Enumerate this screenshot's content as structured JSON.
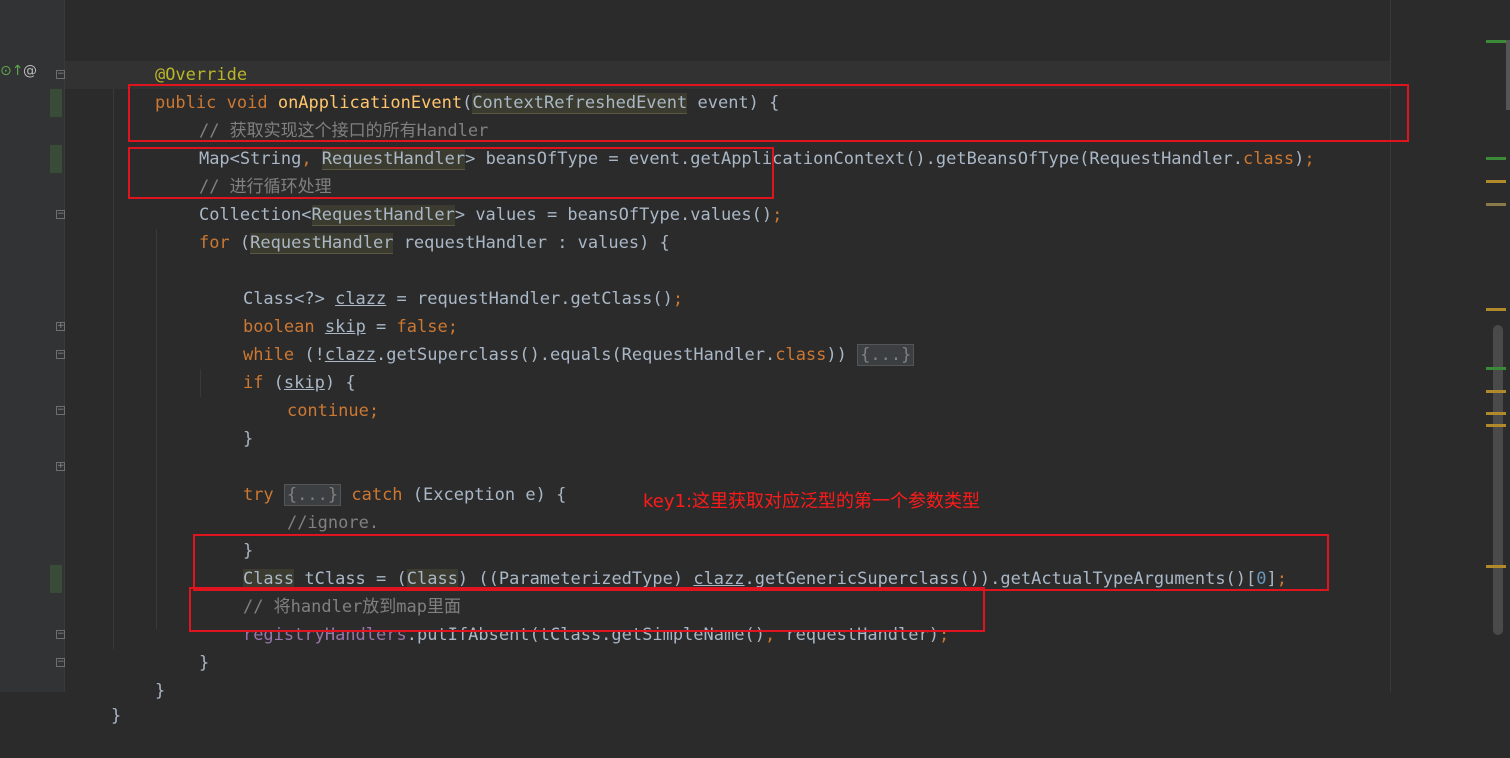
{
  "editor": {
    "lines": {
      "l0": {
        "text": "@Override"
      },
      "l1": {
        "kw_public": "public",
        "kw_void": "void",
        "method": "onApplicationEvent",
        "paren_open": "(",
        "param_type": "ContextRefreshedEvent",
        "param_rest": " event) {"
      },
      "l2": {
        "comment": "// 获取实现这个接口的所有Handler"
      },
      "l3": {
        "a": "Map<String",
        "comma": ", ",
        "hl": "RequestHandler",
        "b": "> beansOfType = event.getApplicationContext().getBeansOfType(RequestHandler.",
        "kw": "class",
        "c": ")",
        "semi": ";"
      },
      "l4": {
        "comment": "// 进行循环处理"
      },
      "l5": {
        "a": "Collection<",
        "hl": "RequestHandler",
        "b": "> values = beansOfType.values()",
        "semi": ";"
      },
      "l6": {
        "kw": "for",
        "a": " (",
        "hl": "RequestHandler",
        "b": " requestHandler : values) {"
      },
      "l7": {
        "a": "Class<?> ",
        "var": "clazz",
        "b": " = requestHandler.getClass()",
        "semi": ";"
      },
      "l8": {
        "kw": "boolean",
        "sp": " ",
        "var": "skip",
        "b": " = ",
        "kw2": "false",
        "semi": ";"
      },
      "l9": {
        "kw": "while",
        "a": " (!",
        "var": "clazz",
        "b": ".getSuperclass().equals(RequestHandler.",
        "kw2": "class",
        "c": ")) ",
        "fold": "{...}"
      },
      "l10": {
        "kw": "if",
        "a": " (",
        "var": "skip",
        "b": ") {"
      },
      "l11": {
        "kw": "continue",
        "semi": ";"
      },
      "l12": {
        "a": "}"
      },
      "l13": {
        "kw": "try",
        "sp": " ",
        "fold": "{...}",
        "sp2": " ",
        "kw2": "catch",
        "a": " (Exception e) {"
      },
      "l14": {
        "comment": "//ignore."
      },
      "l15": {
        "a": "}"
      },
      "l16": {
        "hl1": "Class",
        "a": " tClass = (",
        "hl2": "Class",
        "b": ") ((ParameterizedType) ",
        "var": "clazz",
        "c": ".getGenericSuperclass()).getActualTypeArguments()[",
        "num": "0",
        "d": "]",
        "semi": ";"
      },
      "l17": {
        "comment": "// 将handler放到map里面"
      },
      "l18": {
        "field": "registryHandlers",
        "a": ".putIfAbsent(tClass.getSimpleName()",
        "comma": ", ",
        "b": "requestHandler)",
        "semi": ";"
      },
      "l19": {
        "a": "}"
      },
      "l20": {
        "a": "}"
      },
      "l21": {
        "a": "}"
      }
    },
    "gutter": {
      "at_symbol": "@"
    }
  },
  "annotation": {
    "note": "key1:这里获取对应泛型的第一个参数类型"
  },
  "colors": {
    "background": "#2b2b2b",
    "keyword": "#cc7832",
    "method": "#ffc66d",
    "comment": "#808080",
    "annotation_box": "#e0141e"
  }
}
